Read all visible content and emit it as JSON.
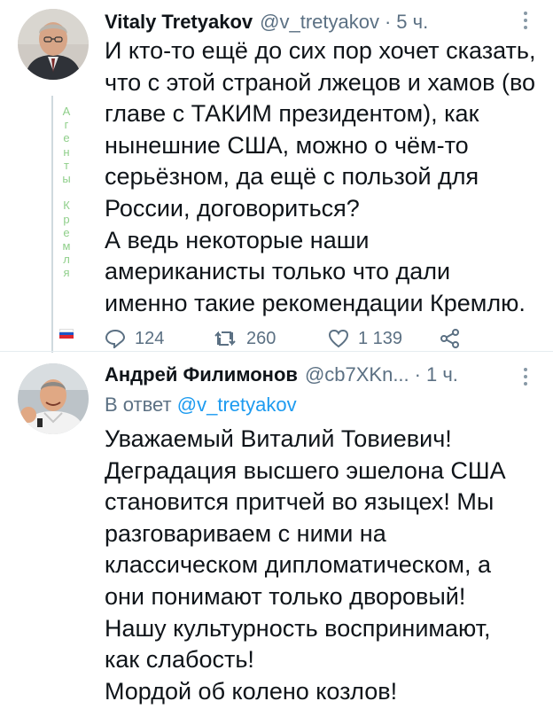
{
  "tweet1": {
    "author_name": "Vitaly Tretyakov",
    "handle": "@v_tretyakov",
    "separator": "·",
    "time": "5 ч.",
    "text_lines": [
      "И кто-то ещё до сих пор хочет сказать,",
      "что с этой страной лжецов и хамов (во",
      "главе с ТАКИМ президентом), как",
      "нынешние США, можно о чём-то",
      "серьёзном, да ещё с пользой для",
      "России, договориться?",
      "А ведь некоторые наши",
      "американисты только что дали",
      "именно такие рекомендации Кремлю."
    ],
    "actions": {
      "replies": "124",
      "retweets": "260",
      "likes": "1 139"
    },
    "side_label": [
      "А",
      "г",
      "е",
      "н",
      "т",
      "ы",
      "",
      "К",
      "р",
      "е",
      "м",
      "л",
      "я"
    ]
  },
  "tweet2": {
    "author_name": "Андрей Филимонов",
    "handle": "@cb7XKn...",
    "separator": "·",
    "time": "1 ч.",
    "reply_prefix": "В ответ",
    "reply_to": "@v_tretyakov",
    "text_lines": [
      "Уважаемый Виталий Товиевич!",
      "Деградация высшего эшелона США",
      "становится притчей во языцех! Мы",
      "разговариваем с ними на",
      "классическом дипломатическом, а",
      "они понимают только дворовый!",
      "Нашу культурность воспринимают,",
      "как слабость!",
      "Мордой об колено козлов!"
    ]
  },
  "colors": {
    "accent": "#1d9bf0",
    "muted": "#5b7083",
    "side_label": "#8fcf8a"
  },
  "icons": {
    "reply": "reply-icon",
    "retweet": "retweet-icon",
    "like": "heart-icon",
    "share": "share-icon",
    "more": "more-icon"
  }
}
